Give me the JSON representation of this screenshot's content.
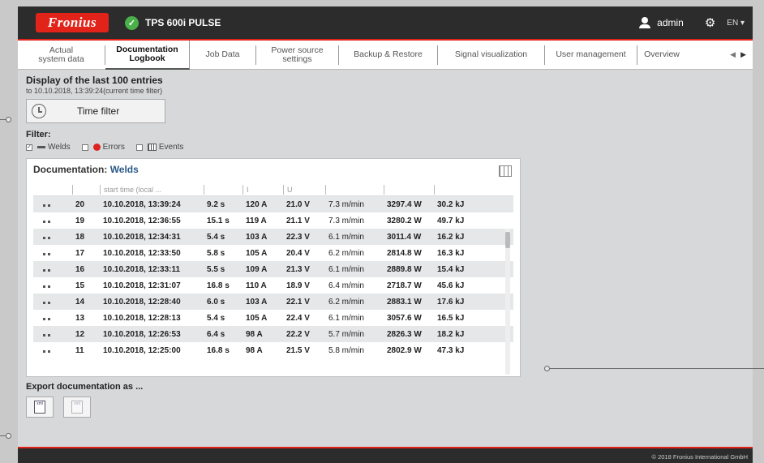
{
  "header": {
    "logo": "Fronius",
    "device": "TPS 600i PULSE",
    "user": "admin",
    "lang": "EN ▾"
  },
  "tabs": [
    {
      "label": "Actual\nsystem data"
    },
    {
      "label": "Documentation\nLogbook"
    },
    {
      "label": "Job Data"
    },
    {
      "label": "Power source\nsettings"
    },
    {
      "label": "Backup & Restore"
    },
    {
      "label": "Signal visualization"
    },
    {
      "label": "User management"
    },
    {
      "label": "Overview"
    }
  ],
  "tab_arrows": {
    "prev": "◀",
    "next": "▶"
  },
  "main": {
    "headline": "Display of the last 100 entries",
    "subline": "to 10.10.2018, 13:39:24(current time filter)",
    "time_filter_label": "Time filter",
    "filter_label": "Filter:",
    "filters": {
      "welds": "Welds",
      "errors": "Errors",
      "events": "Events",
      "checked": "✓"
    },
    "panel_title_prefix": "Documentation:",
    "panel_title_value": "Welds",
    "columns": [
      "",
      "",
      "start time (local ...",
      "",
      "I",
      "U",
      "",
      "",
      ""
    ],
    "rows": [
      [
        "20",
        "10.10.2018, 13:39:24",
        "9.2 s",
        "120 A",
        "21.0 V",
        "7.3 m/min",
        "3297.4 W",
        "30.2 kJ"
      ],
      [
        "19",
        "10.10.2018, 12:36:55",
        "15.1 s",
        "119 A",
        "21.1 V",
        "7.3 m/min",
        "3280.2 W",
        "49.7 kJ"
      ],
      [
        "18",
        "10.10.2018, 12:34:31",
        "5.4 s",
        "103 A",
        "22.3 V",
        "6.1 m/min",
        "3011.4 W",
        "16.2 kJ"
      ],
      [
        "17",
        "10.10.2018, 12:33:50",
        "5.8 s",
        "105 A",
        "20.4 V",
        "6.2 m/min",
        "2814.8 W",
        "16.3 kJ"
      ],
      [
        "16",
        "10.10.2018, 12:33:11",
        "5.5 s",
        "109 A",
        "21.3 V",
        "6.1 m/min",
        "2889.8 W",
        "15.4 kJ"
      ],
      [
        "15",
        "10.10.2018, 12:31:07",
        "16.8 s",
        "110 A",
        "18.9 V",
        "6.4 m/min",
        "2718.7 W",
        "45.6 kJ"
      ],
      [
        "14",
        "10.10.2018, 12:28:40",
        "6.0 s",
        "103 A",
        "22.1 V",
        "6.2 m/min",
        "2883.1 W",
        "17.6 kJ"
      ],
      [
        "13",
        "10.10.2018, 12:28:13",
        "5.4 s",
        "105 A",
        "22.4 V",
        "6.1 m/min",
        "3057.6 W",
        "16.5 kJ"
      ],
      [
        "12",
        "10.10.2018, 12:26:53",
        "6.4 s",
        "98 A",
        "22.2 V",
        "5.7 m/min",
        "2826.3 W",
        "18.2 kJ"
      ],
      [
        "11",
        "10.10.2018, 12:25:00",
        "16.8 s",
        "98 A",
        "21.5 V",
        "5.8 m/min",
        "2802.9 W",
        "47.3 kJ"
      ]
    ],
    "export_label": "Export documentation as ...",
    "export_buttons": [
      {
        "label": "xml"
      },
      {
        "label": "xml"
      }
    ]
  },
  "footer": {
    "copyright": "© 2018 Fronius International GmbH"
  },
  "colors": {
    "brand_red": "#e2231a",
    "topbar": "#2c2c2c",
    "ok_green": "#4ab04a",
    "accent_blue": "#2a5a8a"
  }
}
